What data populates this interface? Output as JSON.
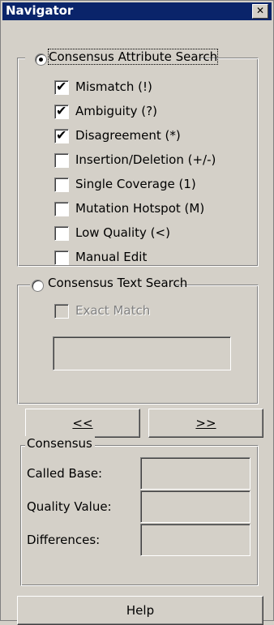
{
  "window": {
    "title": "Navigator",
    "close_glyph": "✕"
  },
  "attribute_search": {
    "label": "Consensus Attribute Search",
    "selected": true,
    "items": [
      {
        "label": "Mismatch (!)",
        "checked": true
      },
      {
        "label": "Ambiguity (?)",
        "checked": true
      },
      {
        "label": "Disagreement (*)",
        "checked": true
      },
      {
        "label": "Insertion/Deletion (+/-)",
        "checked": false
      },
      {
        "label": "Single Coverage (1)",
        "checked": false
      },
      {
        "label": "Mutation Hotspot (M)",
        "checked": false
      },
      {
        "label": "Low Quality (<)",
        "checked": false
      },
      {
        "label": "Manual Edit",
        "checked": false
      }
    ]
  },
  "text_search": {
    "label": "Consensus Text Search",
    "selected": false,
    "exact_match_label": "Exact Match",
    "query_value": ""
  },
  "nav": {
    "prev_label": "<<",
    "next_label": ">>"
  },
  "consensus": {
    "label": "Consensus",
    "called_base_label": "Called Base:",
    "called_base_value": "",
    "quality_value_label": "Quality Value:",
    "quality_value_value": "",
    "differences_label": "Differences:",
    "differences_value": ""
  },
  "help_label": "Help",
  "icons": {
    "check": "check-icon",
    "radio_dot": "radio-dot-icon",
    "close": "close-icon"
  }
}
